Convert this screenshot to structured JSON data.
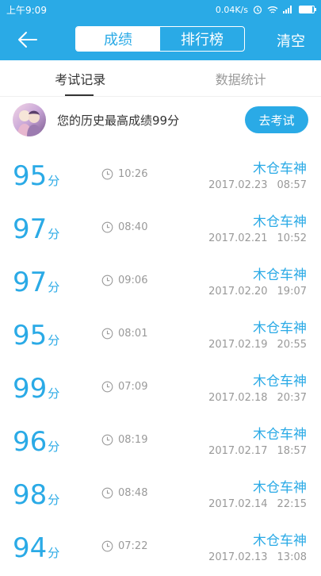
{
  "status_bar": {
    "time": "上午9:09",
    "network_speed": "0.04K/s",
    "battery_level": 0.9
  },
  "header": {
    "back_icon": "arrow-left-icon",
    "segments": [
      {
        "label": "成绩",
        "active": true
      },
      {
        "label": "排行榜",
        "active": false
      }
    ],
    "clear_label": "清空"
  },
  "tabs": [
    {
      "label": "考试记录",
      "active": true
    },
    {
      "label": "数据统计",
      "active": false
    }
  ],
  "summary": {
    "text": "您的历史最高成绩99分",
    "button_label": "去考试"
  },
  "score_unit": "分",
  "records": [
    {
      "score": "95",
      "duration": "10:26",
      "name": "木仓车神",
      "date": "2017.02.23",
      "time": "08:57"
    },
    {
      "score": "97",
      "duration": "08:40",
      "name": "木仓车神",
      "date": "2017.02.21",
      "time": "10:52"
    },
    {
      "score": "97",
      "duration": "09:06",
      "name": "木仓车神",
      "date": "2017.02.20",
      "time": "19:07"
    },
    {
      "score": "95",
      "duration": "08:01",
      "name": "木仓车神",
      "date": "2017.02.19",
      "time": "20:55"
    },
    {
      "score": "99",
      "duration": "07:09",
      "name": "木仓车神",
      "date": "2017.02.18",
      "time": "20:37"
    },
    {
      "score": "96",
      "duration": "08:19",
      "name": "木仓车神",
      "date": "2017.02.17",
      "time": "18:57"
    },
    {
      "score": "98",
      "duration": "08:48",
      "name": "木仓车神",
      "date": "2017.02.14",
      "time": "22:15"
    },
    {
      "score": "94",
      "duration": "07:22",
      "name": "木仓车神",
      "date": "2017.02.13",
      "time": "13:08"
    }
  ],
  "colors": {
    "accent": "#2aaae6",
    "muted_text": "#999999"
  }
}
